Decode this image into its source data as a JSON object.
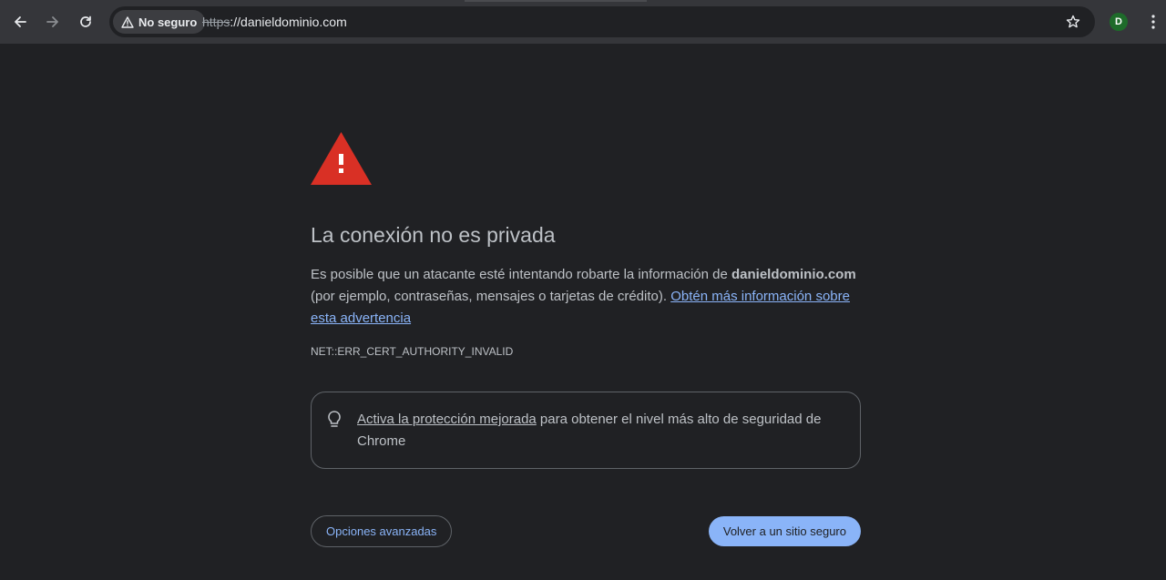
{
  "toolbar": {
    "security_chip_label": "No seguro",
    "url_scheme": "https",
    "url_rest": "://danieldominio.com",
    "avatar_initial": "D"
  },
  "interstitial": {
    "heading": "La conexión no es privada",
    "explanation_prefix": "Es posible que un atacante esté intentando robarte la información de ",
    "domain": "danieldominio.com",
    "explanation_suffix": " (por ejemplo, contraseñas, mensajes o tarjetas de crédito). ",
    "learn_more_link": "Obtén más información sobre esta advertencia",
    "error_code": "NET::ERR_CERT_AUTHORITY_INVALID",
    "promo_link": "Activa la protección mejorada",
    "promo_text": " para obtener el nivel más alto de seguridad de Chrome",
    "advanced_button": "Opciones avanzadas",
    "back_button": "Volver a un sitio seguro"
  },
  "colors": {
    "page_background": "#202124",
    "toolbar_background": "#35363a",
    "text": "#bdc1c6",
    "link": "#8ab4f8",
    "warning_red": "#d93025",
    "primary_button": "#8ab4f8"
  },
  "icons": {
    "back": "arrow-left-icon",
    "forward": "arrow-right-icon",
    "reload": "reload-icon",
    "not_secure": "warning-triangle-icon",
    "bookmark": "star-icon",
    "menu": "kebab-menu-icon",
    "warning": "red-warning-triangle-icon",
    "tip": "lightbulb-icon"
  }
}
